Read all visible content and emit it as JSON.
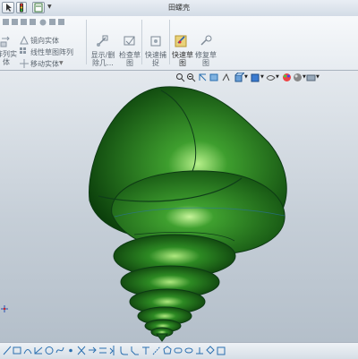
{
  "window": {
    "title": "田螺壳"
  },
  "ribbon": {
    "pattern_body_label": "阵列实体",
    "mirror_body_label": "镜向实体",
    "linear_sketch_pattern_label": "线性草图阵列",
    "move_body_label": "移动实体",
    "display_delete_label": "显示/删除几...",
    "check_sketch_label": "检查草图",
    "quick_snap_label": "快速捕捉",
    "quick_sketch_label": "快速草图",
    "repair_sketch_label": "修复草图"
  },
  "colors": {
    "shell": "#1f7a1f",
    "accent": "#2a6fb0",
    "viewport_top": "#e4e9ee"
  }
}
